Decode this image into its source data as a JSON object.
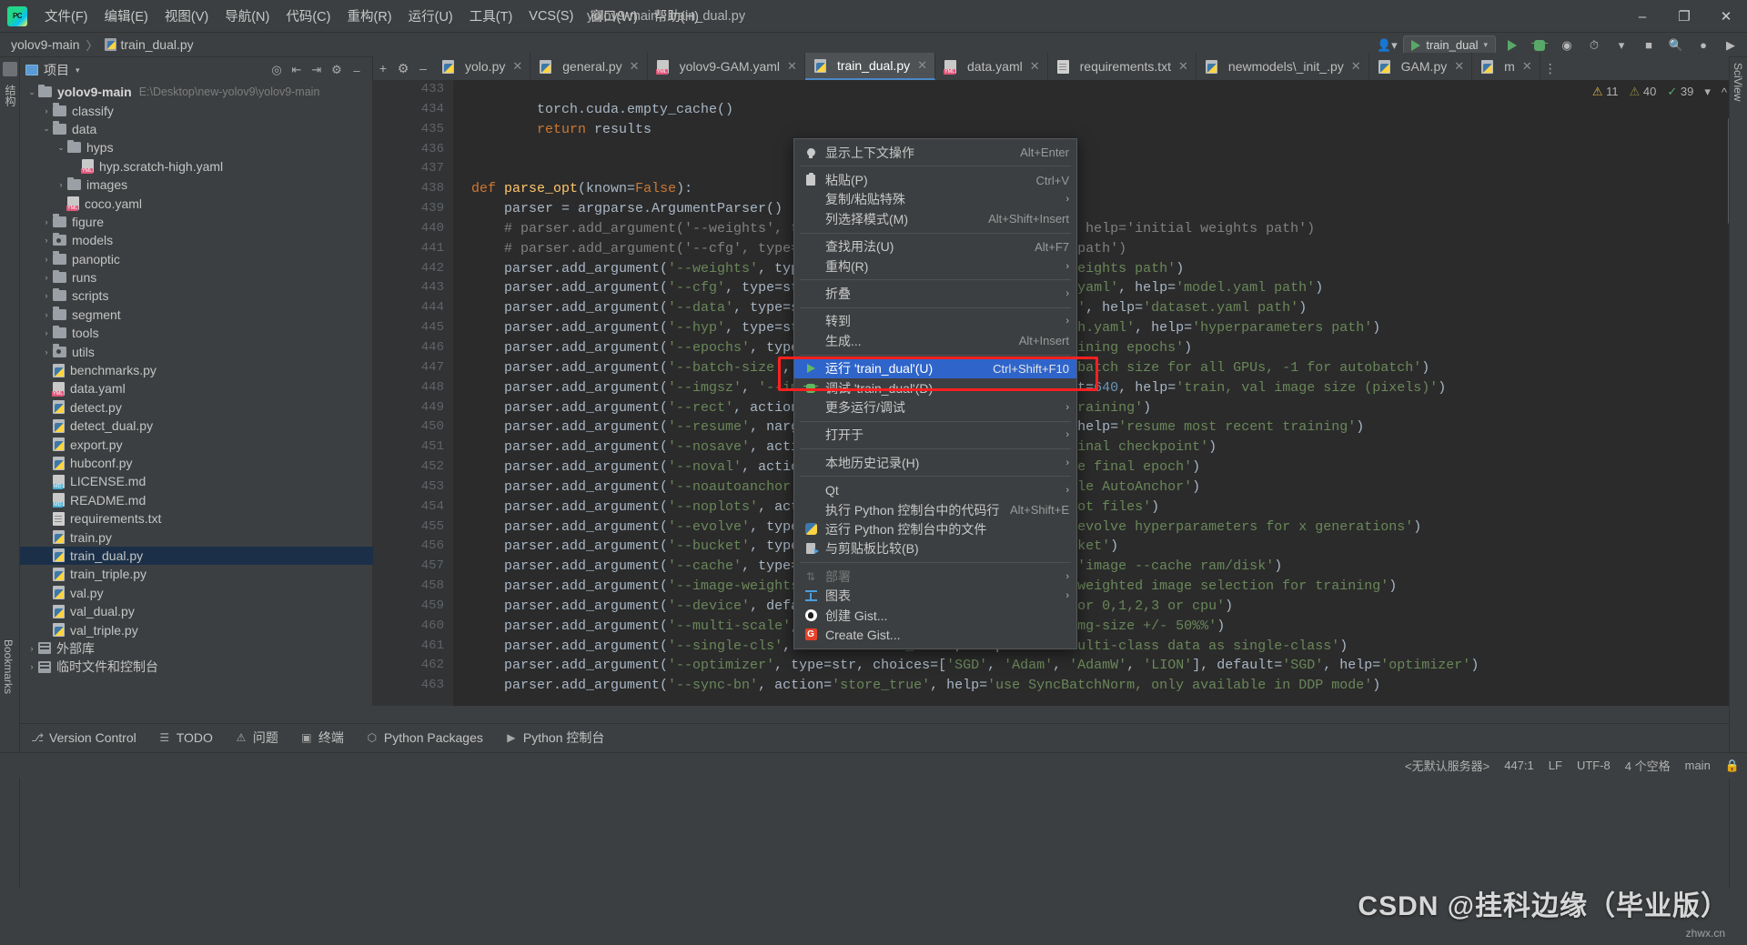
{
  "window": {
    "title": "yolov9-main - train_dual.py",
    "controls": {
      "minimize": "–",
      "maximize": "❐",
      "close": "✕"
    }
  },
  "menubar": [
    {
      "label": "文件(F)"
    },
    {
      "label": "编辑(E)"
    },
    {
      "label": "视图(V)"
    },
    {
      "label": "导航(N)"
    },
    {
      "label": "代码(C)"
    },
    {
      "label": "重构(R)"
    },
    {
      "label": "运行(U)"
    },
    {
      "label": "工具(T)"
    },
    {
      "label": "VCS(S)"
    },
    {
      "label": "窗口(W)"
    },
    {
      "label": "帮助(H)"
    }
  ],
  "breadcrumb": {
    "project": "yolov9-main",
    "separator": "〉",
    "file": "train_dual.py"
  },
  "toolbar": {
    "run_config": "train_dual",
    "dropdown_caret": "▾",
    "icons": [
      "run-icon",
      "debug-icon",
      "coverage-icon",
      "profile-icon",
      "more-icon",
      "stop-icon",
      "search-icon",
      "plugin-icon",
      "updates-icon"
    ],
    "user_icon": "user-icon",
    "user_caret": "▾"
  },
  "project_panel": {
    "header_title": "项目",
    "header_caret": "▾",
    "header_icons": [
      "locate-icon",
      "collapse-all-icon",
      "expand-icon",
      "settings-icon",
      "hide-icon"
    ],
    "tree": [
      {
        "indent": 0,
        "arrow": "⌄",
        "type": "folder",
        "label": "yolov9-main",
        "bold": true,
        "path": "E:\\Desktop\\new-yolov9\\yolov9-main"
      },
      {
        "indent": 1,
        "arrow": "›",
        "type": "folder",
        "label": "classify"
      },
      {
        "indent": 1,
        "arrow": "⌄",
        "type": "folder",
        "label": "data"
      },
      {
        "indent": 2,
        "arrow": "⌄",
        "type": "folder",
        "label": "hyps"
      },
      {
        "indent": 3,
        "arrow": "",
        "type": "yml",
        "label": "hyp.scratch-high.yaml"
      },
      {
        "indent": 2,
        "arrow": "›",
        "type": "folder",
        "label": "images"
      },
      {
        "indent": 2,
        "arrow": "",
        "type": "yml",
        "label": "coco.yaml"
      },
      {
        "indent": 1,
        "arrow": "›",
        "type": "folder",
        "label": "figure"
      },
      {
        "indent": 1,
        "arrow": "›",
        "type": "folder-src",
        "label": "models"
      },
      {
        "indent": 1,
        "arrow": "›",
        "type": "folder",
        "label": "panoptic"
      },
      {
        "indent": 1,
        "arrow": "›",
        "type": "folder",
        "label": "runs"
      },
      {
        "indent": 1,
        "arrow": "›",
        "type": "folder",
        "label": "scripts"
      },
      {
        "indent": 1,
        "arrow": "›",
        "type": "folder",
        "label": "segment"
      },
      {
        "indent": 1,
        "arrow": "›",
        "type": "folder",
        "label": "tools"
      },
      {
        "indent": 1,
        "arrow": "›",
        "type": "folder-src",
        "label": "utils"
      },
      {
        "indent": 1,
        "arrow": "",
        "type": "py",
        "label": "benchmarks.py"
      },
      {
        "indent": 1,
        "arrow": "",
        "type": "yml",
        "label": "data.yaml"
      },
      {
        "indent": 1,
        "arrow": "",
        "type": "py",
        "label": "detect.py"
      },
      {
        "indent": 1,
        "arrow": "",
        "type": "py",
        "label": "detect_dual.py"
      },
      {
        "indent": 1,
        "arrow": "",
        "type": "py",
        "label": "export.py"
      },
      {
        "indent": 1,
        "arrow": "",
        "type": "py",
        "label": "hubconf.py"
      },
      {
        "indent": 1,
        "arrow": "",
        "type": "md",
        "label": "LICENSE.md"
      },
      {
        "indent": 1,
        "arrow": "",
        "type": "md",
        "label": "README.md"
      },
      {
        "indent": 1,
        "arrow": "",
        "type": "txt",
        "label": "requirements.txt"
      },
      {
        "indent": 1,
        "arrow": "",
        "type": "py",
        "label": "train.py"
      },
      {
        "indent": 1,
        "arrow": "",
        "type": "py",
        "label": "train_dual.py",
        "selected": true
      },
      {
        "indent": 1,
        "arrow": "",
        "type": "py",
        "label": "train_triple.py"
      },
      {
        "indent": 1,
        "arrow": "",
        "type": "py",
        "label": "val.py"
      },
      {
        "indent": 1,
        "arrow": "",
        "type": "py",
        "label": "val_dual.py"
      },
      {
        "indent": 1,
        "arrow": "",
        "type": "py",
        "label": "val_triple.py"
      },
      {
        "indent": 0,
        "arrow": "›",
        "type": "lib",
        "label": "外部库"
      },
      {
        "indent": 0,
        "arrow": "›",
        "type": "lib",
        "label": "临时文件和控制台"
      }
    ]
  },
  "left_strip": {
    "labels": [
      "项目",
      "结构",
      "Bookmarks"
    ]
  },
  "right_strip": {
    "labels": [
      "SciView"
    ]
  },
  "editor_tabs": [
    {
      "label": "yolo.py",
      "type": "py",
      "active": false
    },
    {
      "label": "general.py",
      "type": "py",
      "active": false
    },
    {
      "label": "yolov9-GAM.yaml",
      "type": "yml",
      "active": false
    },
    {
      "label": "train_dual.py",
      "type": "py",
      "active": true
    },
    {
      "label": "data.yaml",
      "type": "yml",
      "active": false
    },
    {
      "label": "requirements.txt",
      "type": "txt",
      "active": false
    },
    {
      "label": "newmodels\\_init_.py",
      "type": "py",
      "active": false
    },
    {
      "label": "GAM.py",
      "type": "py",
      "active": false
    },
    {
      "label": "m",
      "type": "py",
      "active": false
    }
  ],
  "inspection": {
    "warnings": "11",
    "weak_warnings": "40",
    "ok": "39",
    "warn_icon": "warning-icon",
    "check_icon": "check-icon"
  },
  "code": {
    "first_line": 433,
    "lines": [
      {
        "n": 433,
        "text": ""
      },
      {
        "n": 434,
        "text": "        torch.cuda.empty_cache()"
      },
      {
        "n": 435,
        "text": "        return results"
      },
      {
        "n": 436,
        "text": ""
      },
      {
        "n": 437,
        "text": ""
      },
      {
        "n": 438,
        "text": "def parse_opt(known=False):"
      },
      {
        "n": 439,
        "text": "    parser = argparse.ArgumentParser()"
      },
      {
        "n": 440,
        "text": "    # parser.add_argument('--weights', type=str, default=ROOT / 'yolo.pt', help='initial weights path')"
      },
      {
        "n": 441,
        "text": "    # parser.add_argument('--cfg', type=str, default='', help='model.yaml path')"
      },
      {
        "n": 442,
        "text": "    parser.add_argument('--weights', type=str, default='', help='initial weights path')"
      },
      {
        "n": 443,
        "text": "    parser.add_argument('--cfg', type=str, default='models/detect/gelan-c.yaml', help='model.yaml path')"
      },
      {
        "n": 444,
        "text": "    parser.add_argument('--data', type=str, default=ROOT / 'data/coco.yaml', help='dataset.yaml path')"
      },
      {
        "n": 445,
        "text": "    parser.add_argument('--hyp', type=str, default=ROOT / 'hyp.scratch-high.yaml', help='hyperparameters path')"
      },
      {
        "n": 446,
        "text": "    parser.add_argument('--epochs', type=int, default=100, help='total training epochs')"
      },
      {
        "n": 447,
        "text": "    parser.add_argument('--batch-size', type=int, default=16, help='total batch size for all GPUs, -1 for autobatch')"
      },
      {
        "n": 448,
        "text": "    parser.add_argument('--imgsz', '--img', '--img-size', type=int, default=640, help='train, val image size (pixels)')"
      },
      {
        "n": 449,
        "text": "    parser.add_argument('--rect', action='store_true', help='rectangular training')"
      },
      {
        "n": 450,
        "text": "    parser.add_argument('--resume', nargs='?', const=True, default=False, help='resume most recent training')"
      },
      {
        "n": 451,
        "text": "    parser.add_argument('--nosave', action='store_true', help='only save final checkpoint')"
      },
      {
        "n": 452,
        "text": "    parser.add_argument('--noval', action='store_true', help='only validate final epoch')"
      },
      {
        "n": 453,
        "text": "    parser.add_argument('--noautoanchor', action='store_true', help='disable AutoAnchor')"
      },
      {
        "n": 454,
        "text": "    parser.add_argument('--noplots', action='store_true', help='save no plot files')"
      },
      {
        "n": 455,
        "text": "    parser.add_argument('--evolve', type=int, nargs='?', const=300, help='evolve hyperparameters for x generations')"
      },
      {
        "n": 456,
        "text": "    parser.add_argument('--bucket', type=str, default='', help='gsutil bucket')"
      },
      {
        "n": 457,
        "text": "    parser.add_argument('--cache', type=str, nargs='?', const='ram', help='image --cache ram/disk')"
      },
      {
        "n": 458,
        "text": "    parser.add_argument('--image-weights', action='store_true', help='use weighted image selection for training')"
      },
      {
        "n": 459,
        "text": "    parser.add_argument('--device', default='', help='cuda device, i.e. 0 or 0,1,2,3 or cpu')"
      },
      {
        "n": 460,
        "text": "    parser.add_argument('--multi-scale', action='store_true', help='vary img-size +/- 50%%')"
      },
      {
        "n": 461,
        "text": "    parser.add_argument('--single-cls', action='store_true', help='train multi-class data as single-class')"
      },
      {
        "n": 462,
        "text": "    parser.add_argument('--optimizer', type=str, choices=['SGD', 'Adam', 'AdamW', 'LION'], default='SGD', help='optimizer')"
      },
      {
        "n": 463,
        "text": "    parser.add_argument('--sync-bn', action='store_true', help='use SyncBatchNorm, only available in DDP mode')"
      }
    ]
  },
  "context_menu": {
    "items": [
      {
        "icon": "lightbulb-icon",
        "label": "显示上下文操作",
        "shortcut": "Alt+Enter",
        "submenu": false
      },
      {
        "sep": true
      },
      {
        "icon": "clipboard-icon",
        "label": "粘贴(P)",
        "shortcut": "Ctrl+V",
        "submenu": false
      },
      {
        "icon": "",
        "label": "复制/粘贴特殊",
        "shortcut": "",
        "submenu": true
      },
      {
        "icon": "",
        "label": "列选择模式(M)",
        "shortcut": "Alt+Shift+Insert",
        "submenu": false
      },
      {
        "sep": true
      },
      {
        "icon": "",
        "label": "查找用法(U)",
        "shortcut": "Alt+F7",
        "submenu": false
      },
      {
        "icon": "",
        "label": "重构(R)",
        "shortcut": "",
        "submenu": true
      },
      {
        "sep": true
      },
      {
        "icon": "",
        "label": "折叠",
        "shortcut": "",
        "submenu": true
      },
      {
        "sep": true
      },
      {
        "icon": "",
        "label": "转到",
        "shortcut": "",
        "submenu": true
      },
      {
        "icon": "",
        "label": "生成...",
        "shortcut": "Alt+Insert",
        "submenu": false
      },
      {
        "sep": true
      },
      {
        "icon": "run-icon",
        "label": "运行 'train_dual'(U)",
        "shortcut": "Ctrl+Shift+F10",
        "submenu": false,
        "highlighted": true
      },
      {
        "icon": "debug-icon",
        "label": "调试 'train_dual'(D)",
        "shortcut": "",
        "submenu": false
      },
      {
        "icon": "",
        "label": "更多运行/调试",
        "shortcut": "",
        "submenu": true
      },
      {
        "sep": true
      },
      {
        "icon": "",
        "label": "打开于",
        "shortcut": "",
        "submenu": true
      },
      {
        "sep": true
      },
      {
        "icon": "",
        "label": "本地历史记录(H)",
        "shortcut": "",
        "submenu": true
      },
      {
        "sep": true
      },
      {
        "icon": "",
        "label": "Qt",
        "shortcut": "",
        "submenu": true
      },
      {
        "icon": "",
        "label": "执行 Python 控制台中的代码行",
        "shortcut": "Alt+Shift+E",
        "submenu": false
      },
      {
        "icon": "python-icon",
        "label": "运行 Python 控制台中的文件",
        "shortcut": "",
        "submenu": false
      },
      {
        "icon": "clipboard-diff-icon",
        "label": "与剪贴板比较(B)",
        "shortcut": "",
        "submenu": false
      },
      {
        "sep": true
      },
      {
        "icon": "deploy-icon",
        "label": "部署",
        "shortcut": "",
        "submenu": true,
        "disabled": true
      },
      {
        "icon": "chart-icon",
        "label": "图表",
        "shortcut": "",
        "submenu": true
      },
      {
        "icon": "github-icon",
        "label": "创建 Gist...",
        "shortcut": "",
        "submenu": false
      },
      {
        "icon": "gitee-icon",
        "label": "Create Gist...",
        "shortcut": "",
        "submenu": false
      }
    ]
  },
  "bottom_bar": [
    {
      "icon": "branch-icon",
      "label": "Version Control"
    },
    {
      "icon": "list-icon",
      "label": "TODO"
    },
    {
      "icon": "problems-icon",
      "label": "问题"
    },
    {
      "icon": "terminal-icon",
      "label": "终端"
    },
    {
      "icon": "packages-icon",
      "label": "Python Packages"
    },
    {
      "icon": "console-icon",
      "label": "Python 控制台"
    }
  ],
  "status_bar": {
    "server": "<无默认服务器>",
    "position": "447:1",
    "line_sep": "LF",
    "encoding": "UTF-8",
    "indent": "4 个空格",
    "branch": "main",
    "lock_icon": "lock-icon"
  },
  "watermark": {
    "text": "CSDN @挂科边缘（毕业版）",
    "small": "zhwx.cn"
  },
  "colors": {
    "accent_blue": "#2f65ca",
    "highlight_red": "#ff2020",
    "run_green": "#5fb85f",
    "editor_bg": "#2b2b2b",
    "panel_bg": "#3c3f41",
    "selection_blue": "#1b3048"
  }
}
